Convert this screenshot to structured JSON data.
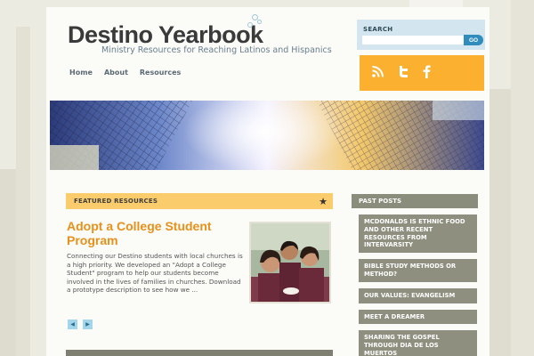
{
  "site": {
    "title": "Destino Yearbook",
    "tagline": "Ministry Resources for Reaching Latinos and Hispanics"
  },
  "nav": {
    "items": [
      "Home",
      "About",
      "Resources"
    ]
  },
  "search": {
    "label": "SEARCH",
    "placeholder": "",
    "button": "GO"
  },
  "social": {
    "icons": [
      "rss-icon",
      "twitter-icon",
      "facebook-icon"
    ]
  },
  "featured": {
    "label": "FEATURED RESOURCES",
    "post_title": "Adopt a College Student Program",
    "excerpt": "Connecting our Destino students with local churches is a high priority. We developed an \"Adopt a College Student\" program to help our students become involved in the lives of families in churches. Download a prototype description to see how we ..."
  },
  "past_posts": {
    "label": "PAST POSTS",
    "items": [
      "McDonalds is Ethnic Food and Other Recent Resources from InterVarsity",
      "Bible Study Methods or Method?",
      "Our Values: Evangelism",
      "Meet a Dreamer",
      "Sharing the Gospel through Dia de los Muertos"
    ]
  },
  "colors": {
    "accent_orange": "#e7901a",
    "social_bar": "#fbb030",
    "featured_bar": "#fbcc6c",
    "past_post_bg": "#8e8f7e",
    "search_button": "#2f8cbc"
  }
}
